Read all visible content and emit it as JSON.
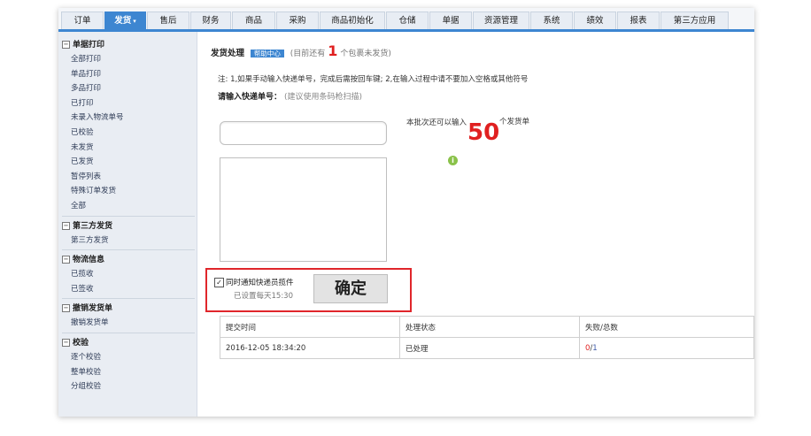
{
  "nav": {
    "tabs": [
      "订单",
      "发货",
      "售后",
      "财务",
      "商品",
      "采购",
      "商品初始化",
      "仓储",
      "单据",
      "资源管理",
      "系统",
      "绩效",
      "报表",
      "第三方应用"
    ],
    "active": 1
  },
  "sidebar": {
    "groups": [
      {
        "title": "单据打印",
        "items": [
          "全部打印",
          "单品打印",
          "多品打印",
          "已打印",
          "未录入物流单号",
          "已校验",
          "未发货",
          "已发货",
          "暂停列表",
          "特殊订单发货",
          "全部"
        ]
      },
      {
        "title": "第三方发货",
        "items": [
          "第三方发货"
        ]
      },
      {
        "title": "物流信息",
        "items": [
          "已揽收",
          "已签收"
        ]
      },
      {
        "title": "撤销发货单",
        "items": [
          "撤销发货单"
        ]
      },
      {
        "title": "校验",
        "items": [
          "逐个校验",
          "整单校验",
          "分组校验"
        ]
      }
    ]
  },
  "main": {
    "title": "发货处理",
    "help_badge": "帮助中心",
    "remain_prefix": "(目前还有",
    "remain_count": "1",
    "remain_suffix": "个包裹未发货)",
    "note": "注: 1,如果手动输入快递单号，完成后需按回车键; 2,在输入过程中请不要加入空格或其他符号",
    "input_label": "请输入快递单号：",
    "input_hint": "(建议使用条码枪扫描)",
    "capacity_prefix": "本批次还可以输入",
    "capacity_num": "50",
    "capacity_suffix": "个发货单",
    "notify_label": "同时通知快递员揽件",
    "notify_sub": "已设置每天15:30",
    "confirm_label": "确定",
    "table": {
      "headers": [
        "提交时间",
        "处理状态",
        "失败/总数"
      ],
      "rows": [
        {
          "time": "2016-12-05 18:34:20",
          "status": "已处理",
          "fail": "0",
          "total": "1"
        }
      ]
    }
  }
}
